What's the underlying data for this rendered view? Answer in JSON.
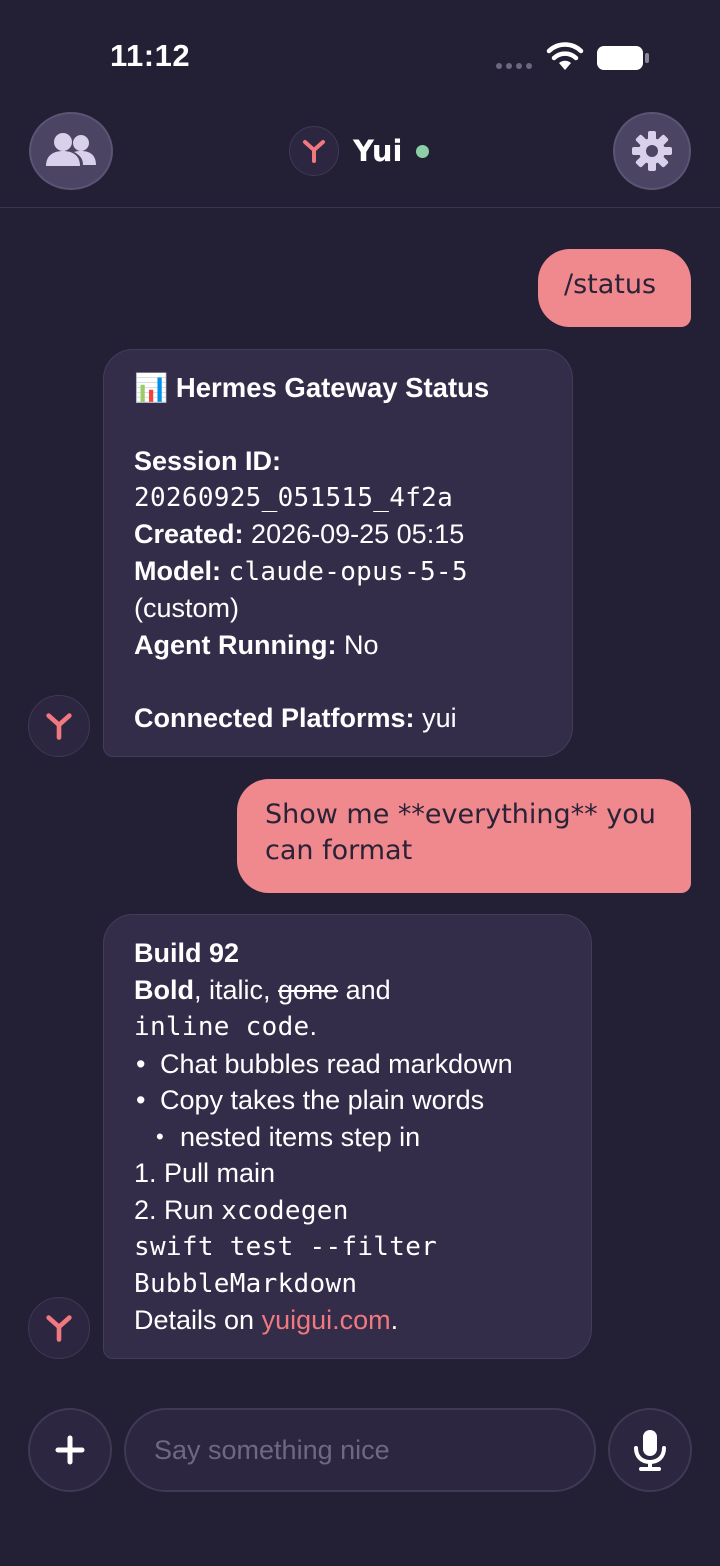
{
  "status_bar": {
    "time": "11:12"
  },
  "header": {
    "name": "Yui"
  },
  "messages": {
    "user1": "/status",
    "status": {
      "emoji": "📊",
      "title": "Hermes Gateway Status",
      "session_label": "Session ID:",
      "session_value": "20260925_051515_4f2a",
      "created_label": "Created:",
      "created_value": "2026-09-25 05:15",
      "model_label": "Model:",
      "model_value": "claude-opus-5-5",
      "model_suffix": "(custom)",
      "agent_label": "Agent Running:",
      "agent_value": "No",
      "platforms_label": "Connected Platforms:",
      "platforms_value": "yui"
    },
    "user2": "Show me **everything** you can format",
    "markdown": {
      "heading": "Build 92",
      "bold": "Bold",
      "italic": ", italic, ",
      "strike": "gone",
      "and": " and",
      "inline_code": "inline code",
      "period": ".",
      "bullet1": "Chat bubbles read markdown",
      "bullet2": "Copy takes the plain words",
      "nested": "nested items step in",
      "step1": "1.  Pull main",
      "step2_prefix": "2.  Run ",
      "step2_code": "xcodegen",
      "code_block_1": "swift test --filter",
      "code_block_2": "BubbleMarkdown",
      "details_prefix": "Details on ",
      "details_link": "yuigui.com",
      "details_suffix": "."
    }
  },
  "composer": {
    "placeholder": "Say something nice"
  },
  "colors": {
    "background": "#231f35",
    "user_bubble": "#f0898e",
    "bot_bubble": "#332d4a",
    "accent": "#f0787e",
    "online": "#8ccfa7"
  },
  "icons": [
    "people-icon",
    "gear-icon",
    "yui-logo-icon",
    "plus-icon",
    "microphone-icon",
    "wifi-icon",
    "battery-icon"
  ]
}
